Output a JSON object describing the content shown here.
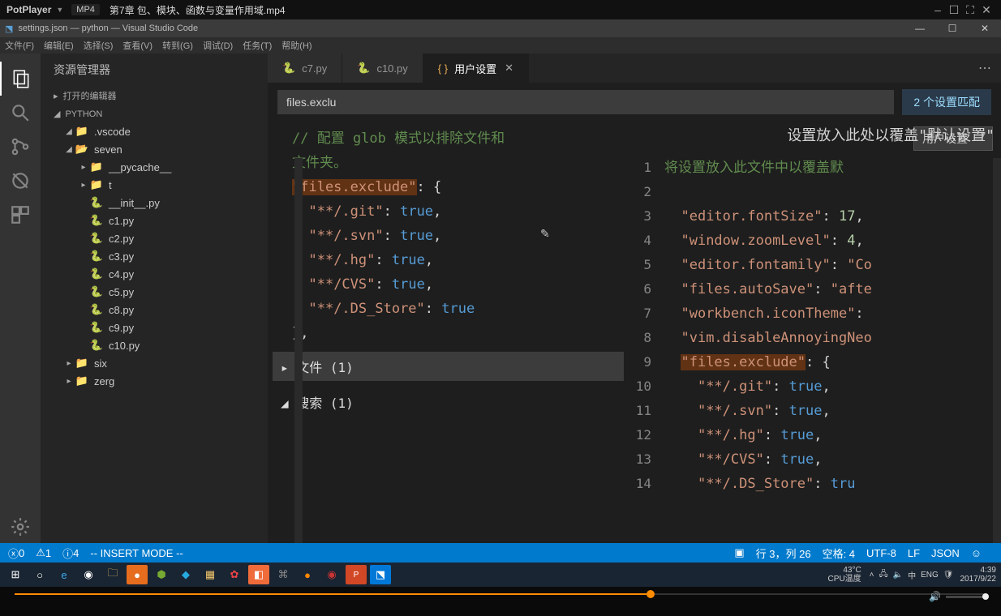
{
  "potplayer": {
    "logo": "PotPlayer",
    "format": "MP4",
    "title": "第7章 包、模块、函数与变量作用域.mp4"
  },
  "vscode": {
    "titlebar": "settings.json — python — Visual Studio Code",
    "menus": [
      "文件(F)",
      "编辑(E)",
      "选择(S)",
      "查看(V)",
      "转到(G)",
      "调试(D)",
      "任务(T)",
      "帮助(H)"
    ],
    "sidebar_title": "资源管理器",
    "sections": {
      "opened": "打开的编辑器",
      "project": "PYTHON"
    },
    "tree": {
      "vscode": ".vscode",
      "seven": "seven",
      "pycache": "__pycache__",
      "t": "t",
      "files": [
        "__init__.py",
        "c1.py",
        "c2.py",
        "c3.py",
        "c4.py",
        "c5.py",
        "c8.py",
        "c9.py",
        "c10.py"
      ],
      "six": "six",
      "zerg": "zerg"
    },
    "tabs": {
      "c7": "c7.py",
      "c10": "c10.py",
      "settings": "用户设置"
    },
    "search_value": "files.exclu",
    "match_count": "2 个设置匹配",
    "dropdown": "用户设置",
    "left_overline": "设置放入此处以覆盖\"默认设置\"",
    "left_line1": "将设置放入此文件中以覆盖默",
    "comment1": "// 配置 glob 模式以排除文件和",
    "comment2": "文件夹。",
    "files_exclude_key": "\"files.exclude\"",
    "exclude_entries": [
      {
        "k": "\"**/.git\"",
        "v": "true",
        "c": ","
      },
      {
        "k": "\"**/.svn\"",
        "v": "true",
        "c": ","
      },
      {
        "k": "\"**/.hg\"",
        "v": "true",
        "c": ","
      },
      {
        "k": "\"**/CVS\"",
        "v": "true",
        "c": ","
      },
      {
        "k": "\"**/.DS_Store\"",
        "v": "true",
        "c": ""
      }
    ],
    "sect_files": "文件 (1)",
    "sect_search": "搜索 (1)",
    "right_lines": [
      {
        "n": "3",
        "pre": "  ",
        "k": "\"editor.fontSize\"",
        "sep": ": ",
        "v": "17",
        "p": ","
      },
      {
        "n": "4",
        "pre": "  ",
        "k": "\"window.zoomLevel\"",
        "sep": ": ",
        "v": "4",
        "p": ","
      },
      {
        "n": "5",
        "pre": "  ",
        "k": "\"editor.fontamily\"",
        "sep": ": ",
        "v": "\"Co",
        "p": ""
      },
      {
        "n": "6",
        "pre": "  ",
        "k": "\"files.autoSave\"",
        "sep": ": ",
        "v": "\"afte",
        "p": ""
      },
      {
        "n": "7",
        "pre": "  ",
        "k": "\"workbench.iconTheme\"",
        "sep": ":",
        "v": "",
        "p": ""
      },
      {
        "n": "8",
        "pre": "  ",
        "k": "\"vim.disableAnnoyingNeo",
        "sep": "",
        "v": "",
        "p": ""
      }
    ],
    "right_files_exclude": {
      "n": "9",
      "pre": "  ",
      "k": "\"files.exclude\"",
      "sep": ": {",
      "v": "",
      "p": ""
    },
    "right_excludes": [
      {
        "n": "10",
        "k": "\"**/.git\"",
        "v": "true",
        "c": ","
      },
      {
        "n": "11",
        "k": "\"**/.svn\"",
        "v": "true",
        "c": ","
      },
      {
        "n": "12",
        "k": "\"**/.hg\"",
        "v": "true",
        "c": ","
      },
      {
        "n": "13",
        "k": "\"**/CVS\"",
        "v": "true",
        "c": ","
      },
      {
        "n": "14",
        "k": "\"**/.DS_Store\"",
        "v": "tru",
        "c": ""
      }
    ],
    "status": {
      "errors": "0",
      "warnings": "1",
      "info": "4",
      "mode": "-- INSERT MODE --",
      "pos": "行 3，列 26",
      "spaces": "空格: 4",
      "encoding": "UTF-8",
      "eol": "LF",
      "lang": "JSON"
    }
  },
  "taskbar": {
    "temp": "43°C",
    "temp_label": "CPU温度",
    "lang": "中",
    "ime": "ENG",
    "time": "4:39",
    "date": "2017/9/22"
  }
}
